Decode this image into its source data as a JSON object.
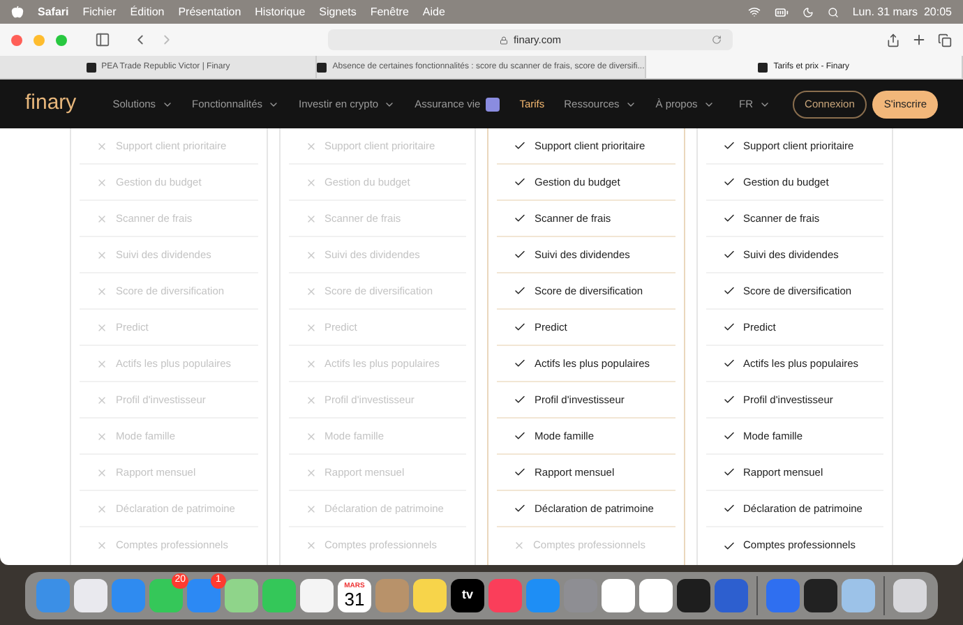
{
  "menu_bar": {
    "app": "Safari",
    "items": [
      "Fichier",
      "Édition",
      "Présentation",
      "Historique",
      "Signets",
      "Fenêtre",
      "Aide"
    ],
    "clock": "Lun. 31 mars  20:05"
  },
  "toolbar": {
    "url": "finary.com"
  },
  "tabs": [
    {
      "label": "PEA Trade Republic Victor | Finary",
      "selected": false
    },
    {
      "label": "Absence de certaines fonctionnalités : score du scanner de frais, score de diversifi...",
      "selected": false
    },
    {
      "label": "Tarifs et prix - Finary",
      "selected": true
    }
  ],
  "nav": {
    "logo": "finary",
    "items": [
      {
        "label": "Solutions",
        "dropdown": true,
        "selected": false
      },
      {
        "label": "Fonctionnalités",
        "dropdown": true,
        "selected": false
      },
      {
        "label": "Investir en crypto",
        "dropdown": true,
        "selected": false
      },
      {
        "label": "Assurance vie",
        "dropdown": false,
        "selected": false
      },
      {
        "label": "Tarifs",
        "dropdown": false,
        "selected": true
      },
      {
        "label": "Ressources",
        "dropdown": true,
        "selected": false
      },
      {
        "label": "À propos",
        "dropdown": true,
        "selected": false
      }
    ],
    "language": "FR",
    "login": "Connexion",
    "signup": "S'inscrire"
  },
  "plans": [
    {
      "highlighted": false,
      "features": [
        {
          "label": "Support client prioritaire",
          "included": false
        },
        {
          "label": "Gestion du budget",
          "included": false
        },
        {
          "label": "Scanner de frais",
          "included": false
        },
        {
          "label": "Suivi des dividendes",
          "included": false
        },
        {
          "label": "Score de diversification",
          "included": false
        },
        {
          "label": "Predict",
          "included": false
        },
        {
          "label": "Actifs les plus populaires",
          "included": false
        },
        {
          "label": "Profil d'investisseur",
          "included": false
        },
        {
          "label": "Mode famille",
          "included": false
        },
        {
          "label": "Rapport mensuel",
          "included": false
        },
        {
          "label": "Déclaration de patrimoine",
          "included": false
        },
        {
          "label": "Comptes professionnels",
          "included": false
        }
      ]
    },
    {
      "highlighted": false,
      "features": [
        {
          "label": "Support client prioritaire",
          "included": false
        },
        {
          "label": "Gestion du budget",
          "included": false
        },
        {
          "label": "Scanner de frais",
          "included": false
        },
        {
          "label": "Suivi des dividendes",
          "included": false
        },
        {
          "label": "Score de diversification",
          "included": false
        },
        {
          "label": "Predict",
          "included": false
        },
        {
          "label": "Actifs les plus populaires",
          "included": false
        },
        {
          "label": "Profil d'investisseur",
          "included": false
        },
        {
          "label": "Mode famille",
          "included": false
        },
        {
          "label": "Rapport mensuel",
          "included": false
        },
        {
          "label": "Déclaration de patrimoine",
          "included": false
        },
        {
          "label": "Comptes professionnels",
          "included": false
        }
      ]
    },
    {
      "highlighted": true,
      "features": [
        {
          "label": "Support client prioritaire",
          "included": true
        },
        {
          "label": "Gestion du budget",
          "included": true
        },
        {
          "label": "Scanner de frais",
          "included": true
        },
        {
          "label": "Suivi des dividendes",
          "included": true
        },
        {
          "label": "Score de diversification",
          "included": true
        },
        {
          "label": "Predict",
          "included": true
        },
        {
          "label": "Actifs les plus populaires",
          "included": true
        },
        {
          "label": "Profil d'investisseur",
          "included": true
        },
        {
          "label": "Mode famille",
          "included": true
        },
        {
          "label": "Rapport mensuel",
          "included": true
        },
        {
          "label": "Déclaration de patrimoine",
          "included": true
        },
        {
          "label": "Comptes professionnels",
          "included": false
        }
      ]
    },
    {
      "highlighted": false,
      "features": [
        {
          "label": "Support client prioritaire",
          "included": true
        },
        {
          "label": "Gestion du budget",
          "included": true
        },
        {
          "label": "Scanner de frais",
          "included": true
        },
        {
          "label": "Suivi des dividendes",
          "included": true
        },
        {
          "label": "Score de diversification",
          "included": true
        },
        {
          "label": "Predict",
          "included": true
        },
        {
          "label": "Actifs les plus populaires",
          "included": true
        },
        {
          "label": "Profil d'investisseur",
          "included": true
        },
        {
          "label": "Mode famille",
          "included": true
        },
        {
          "label": "Rapport mensuel",
          "included": true
        },
        {
          "label": "Déclaration de patrimoine",
          "included": true
        },
        {
          "label": "Comptes professionnels",
          "included": true
        }
      ]
    }
  ],
  "dock": [
    {
      "kind": "finder"
    },
    {
      "kind": "grid"
    },
    {
      "kind": "compass"
    },
    {
      "kind": "messages",
      "badge": "20"
    },
    {
      "kind": "mail",
      "badge": "1"
    },
    {
      "kind": "maps"
    },
    {
      "kind": "video"
    },
    {
      "kind": "photos"
    },
    {
      "kind": "calendar",
      "month": "MARS",
      "day": "31"
    },
    {
      "kind": "contacts"
    },
    {
      "kind": "notes"
    },
    {
      "kind": "tv",
      "label": "tv"
    },
    {
      "kind": "music"
    },
    {
      "kind": "store"
    },
    {
      "kind": "settings"
    },
    {
      "kind": "scissors"
    },
    {
      "kind": "notebook"
    },
    {
      "kind": "figma"
    },
    {
      "kind": "chart"
    },
    {
      "kind": "separator"
    },
    {
      "kind": "vpn"
    },
    {
      "kind": "clock"
    },
    {
      "kind": "preview"
    },
    {
      "kind": "separator"
    },
    {
      "kind": "trash"
    }
  ]
}
